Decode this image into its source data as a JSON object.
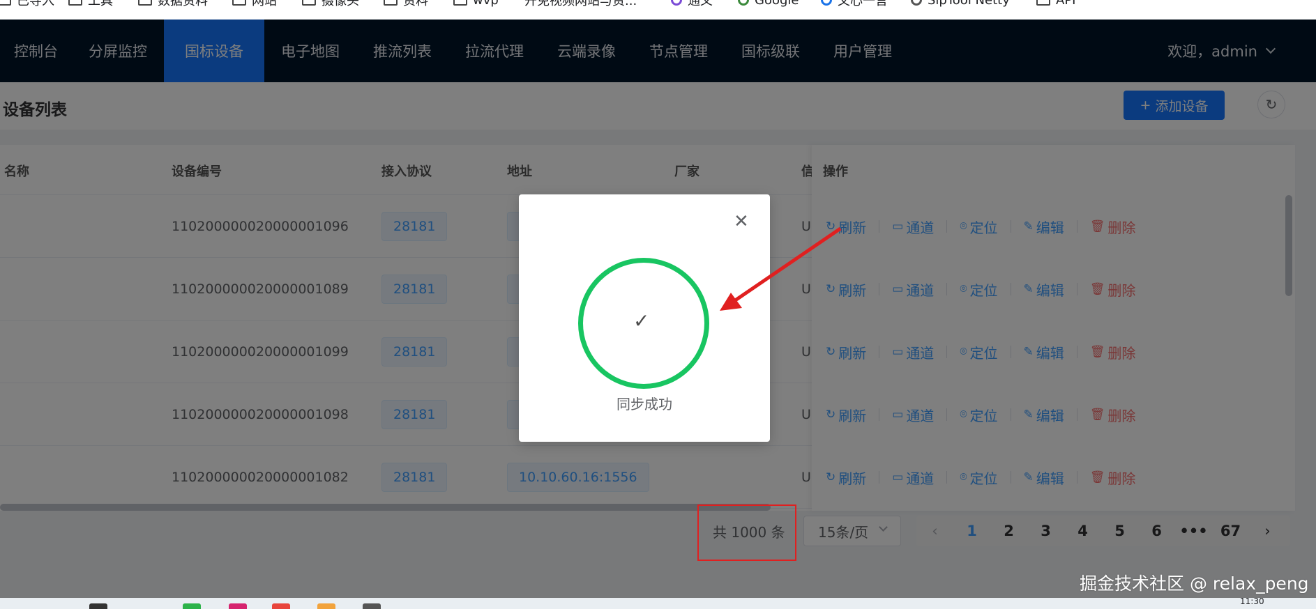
{
  "bookmarks": [
    {
      "label": "已导入",
      "icon": "folder-icon"
    },
    {
      "label": "工具",
      "icon": "folder-icon"
    },
    {
      "label": "数据资料",
      "icon": "folder-icon"
    },
    {
      "label": "网站",
      "icon": "folder-icon"
    },
    {
      "label": "摄像头",
      "icon": "folder-icon"
    },
    {
      "label": "资料",
      "icon": "folder-icon"
    },
    {
      "label": "wvp",
      "icon": "folder-icon"
    },
    {
      "label": "开免视频网站与资...",
      "icon": "page-icon"
    },
    {
      "label": "通义",
      "icon": "tongyi-icon"
    },
    {
      "label": "Google",
      "icon": "google-icon"
    },
    {
      "label": "文心一言",
      "icon": "wenxin-icon"
    },
    {
      "label": "SipTool Netty",
      "icon": "siptool-icon"
    },
    {
      "label": "API",
      "icon": "folder-icon"
    }
  ],
  "nav": {
    "items": [
      "控制台",
      "分屏监控",
      "国标设备",
      "电子地图",
      "推流列表",
      "拉流代理",
      "云端录像",
      "节点管理",
      "国标级联",
      "用户管理"
    ],
    "active_index": 2,
    "welcome": "欢迎，admin"
  },
  "page": {
    "title": "设备列表",
    "add_button": "添加设备",
    "refresh_icon": "refresh-icon"
  },
  "table": {
    "headers": {
      "name": "名称",
      "device_id": "设备编号",
      "protocol": "接入协议",
      "address": "地址",
      "vendor": "厂家",
      "signal": "信",
      "ops": "操作"
    },
    "rows": [
      {
        "device_id": "11020000002000000‌1096",
        "protocol": "28181",
        "address": "",
        "status": "Ul"
      },
      {
        "device_id": "11020000002000000‌1089",
        "protocol": "28181",
        "address": "",
        "status": "Ul"
      },
      {
        "device_id": "11020000002000000‌1099",
        "protocol": "28181",
        "address": "",
        "status": "Ul"
      },
      {
        "device_id": "11020000002000000‌1098",
        "protocol": "28181",
        "address": "",
        "status": "Ul"
      },
      {
        "device_id": "11020000002000000‌1082",
        "protocol": "28181",
        "address": "10.10.60.16:1556",
        "status": "Ul"
      }
    ],
    "ops": {
      "refresh": "刷新",
      "channel": "通道",
      "locate": "定位",
      "edit": "编辑",
      "delete": "删除"
    }
  },
  "pagination": {
    "total": "共 1000 条",
    "page_size": "15条/页",
    "pages": [
      "1",
      "2",
      "3",
      "4",
      "5",
      "6",
      "•••",
      "67"
    ],
    "current": "1"
  },
  "dialog": {
    "message": "同步成功",
    "close_icon": "close-icon",
    "status_icon": "success-check-icon"
  },
  "annotation_colors": {
    "highlight": "#e02020",
    "success": "#18c561",
    "primary": "#1677ff",
    "nav_bg": "#001529"
  },
  "watermark": "掘金技术社区 @ relax_peng",
  "taskbar": {
    "time": "11:30"
  }
}
